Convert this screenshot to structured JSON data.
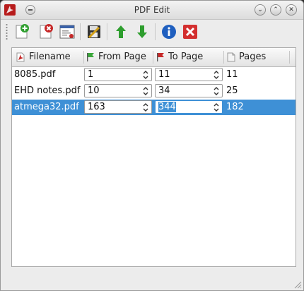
{
  "window": {
    "title": "PDF Edit"
  },
  "toolbar": {
    "buttons": [
      "add-file",
      "remove-file",
      "properties",
      "save",
      "move-up",
      "move-down",
      "info",
      "close"
    ]
  },
  "table": {
    "columns": [
      {
        "label": "Filename",
        "icon": "pdf-icon"
      },
      {
        "label": "From Page",
        "icon": "green-flag-icon"
      },
      {
        "label": "To Page",
        "icon": "red-flag-icon"
      },
      {
        "label": "Pages",
        "icon": "page-icon"
      }
    ],
    "rows": [
      {
        "filename": "8085.pdf",
        "from": "1",
        "to": "11",
        "pages": "11",
        "selected": false
      },
      {
        "filename": "EHD notes.pdf",
        "from": "10",
        "to": "34",
        "pages": "25",
        "selected": false
      },
      {
        "filename": "atmega32.pdf",
        "from": "163",
        "to": "344",
        "pages": "182",
        "selected": true
      }
    ]
  },
  "colors": {
    "selection": "#3e90d6",
    "window_bg": "#ececec"
  }
}
